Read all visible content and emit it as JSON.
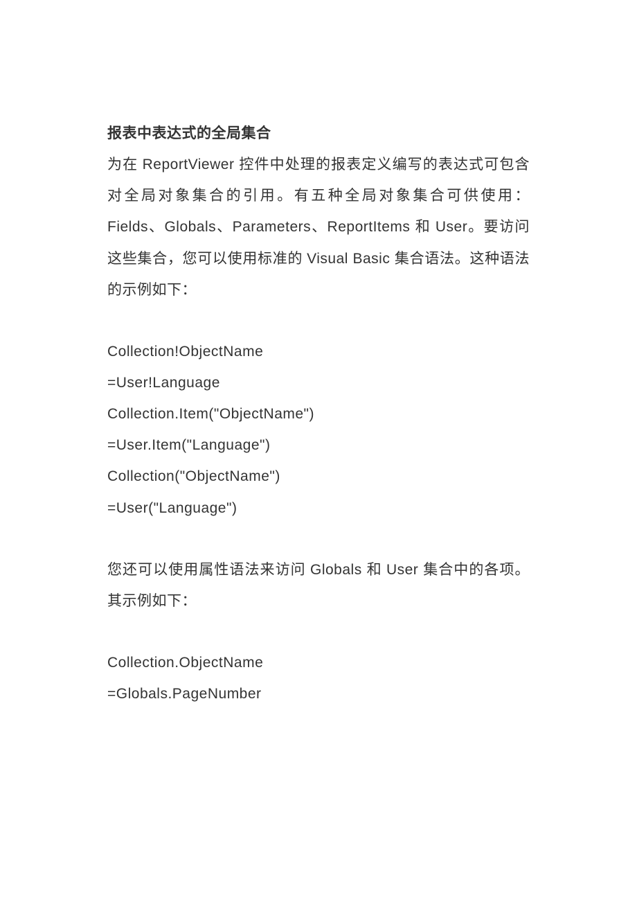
{
  "heading": "报表中表达式的全局集合",
  "para1_parts": [
    {
      "t": "cn",
      "v": "为在 "
    },
    {
      "t": "en",
      "v": "ReportViewer "
    },
    {
      "t": "cn",
      "v": "控件中处理的报表定义编写的表达式可包含对全局对象集合的引用。有五种全局对象集合可供使用："
    },
    {
      "t": "en",
      "v": "Fields"
    },
    {
      "t": "cn",
      "v": "、"
    },
    {
      "t": "en",
      "v": "Globals"
    },
    {
      "t": "cn",
      "v": "、"
    },
    {
      "t": "en",
      "v": "Parameters"
    },
    {
      "t": "cn",
      "v": "、"
    },
    {
      "t": "en",
      "v": "ReportItems "
    },
    {
      "t": "cn",
      "v": "和 "
    },
    {
      "t": "en",
      "v": "User"
    },
    {
      "t": "cn",
      "v": "。要访问这些集合，您可以使用标准的 "
    },
    {
      "t": "en",
      "v": "Visual Basic "
    },
    {
      "t": "cn",
      "v": "集合语法。这种语法的示例如下："
    }
  ],
  "code1": [
    "Collection!ObjectName",
    "=User!Language",
    "Collection.Item(\"ObjectName\")",
    "=User.Item(\"Language\")",
    "Collection(\"ObjectName\")",
    "=User(\"Language\")"
  ],
  "para2_parts": [
    {
      "t": "cn",
      "v": "您还可以使用属性语法来访问 "
    },
    {
      "t": "en",
      "v": "Globals "
    },
    {
      "t": "cn",
      "v": "和 "
    },
    {
      "t": "en",
      "v": "User "
    },
    {
      "t": "cn",
      "v": "集合中的各项。其示例如下："
    }
  ],
  "code2": [
    "Collection.ObjectName",
    "=Globals.PageNumber"
  ]
}
